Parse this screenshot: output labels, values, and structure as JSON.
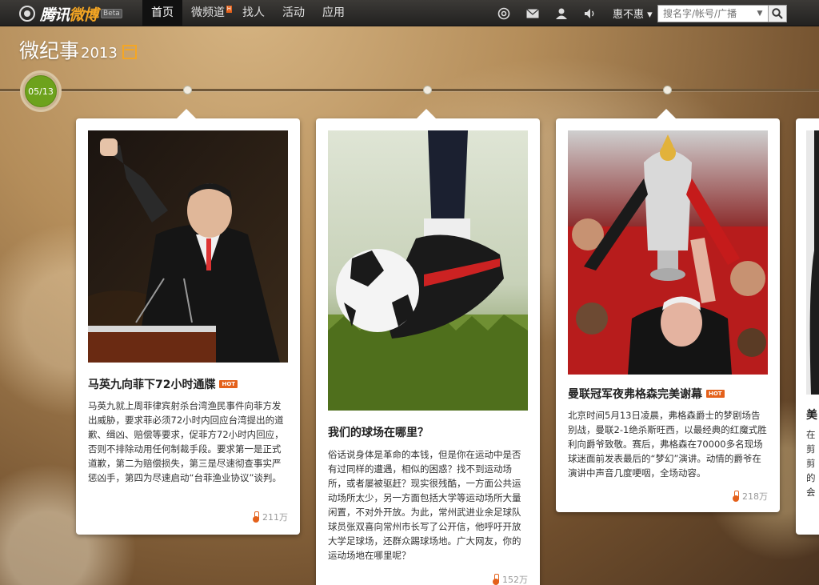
{
  "nav": {
    "logo_text_1": "腾讯",
    "logo_text_2": "微博",
    "beta": "Beta",
    "items": [
      {
        "label": "首页",
        "active": true
      },
      {
        "label": "微频道",
        "badge": "H"
      },
      {
        "label": "找人"
      },
      {
        "label": "活动"
      },
      {
        "label": "应用"
      }
    ],
    "icons": [
      "at-icon",
      "mail-icon",
      "user-icon",
      "speaker-icon"
    ],
    "user_name": "惠不惠",
    "search_placeholder": "搜名字/帐号/广播"
  },
  "header": {
    "title": "微纪事",
    "year": "2013"
  },
  "timeline": {
    "current_date": "05/13"
  },
  "cards": [
    {
      "title": "马英九向菲下72小时通牒",
      "hot": "HOT",
      "body": "马英九就上周菲律宾射杀台湾渔民事件向菲方发出威胁，要求菲必须72小时内回应台湾提出的道歉、缉凶、赔偿等要求，促菲方72小时内回应，否则不排除动用任何制裁手段。要求第一是正式道歉，第二为赔偿损失，第三是尽速彻查事实严惩凶手，第四为尽速启动“台菲渔业协议”谈判。",
      "count": "211万"
    },
    {
      "title": "我们的球场在哪里？",
      "body": "俗话说身体是革命的本钱，但是你在运动中是否有过同样的遭遇，相似的困惑？找不到运动场所，或者屡被驱赶？现实很残酷，一方面公共运动场所太少，另一方面包括大学等运动场所大量闲置，不对外开放。为此，常州武进业余足球队球员张双喜向常州市长写了公开信，他呼吁开放大学足球场，还群众踢球场地。广大网友，你的运动场地在哪里呢？",
      "count": "152万"
    },
    {
      "title": "曼联冠军夜弗格森完美谢幕",
      "hot": "HOT",
      "body": "北京时间5月13日凌晨，弗格森爵士的梦剧场告别战，曼联2-1绝杀斯旺西，以最经典的红魔式胜利向爵爷致敬。赛后，弗格森在70000多名现场球迷面前发表最后的“梦幻”演讲。动情的爵爷在演讲中声音几度哽咽，全场动容。",
      "count": "218万"
    }
  ],
  "partial_card": {
    "title": "美",
    "lines": [
      "在",
      "剪",
      "剪",
      "的",
      "会"
    ]
  }
}
